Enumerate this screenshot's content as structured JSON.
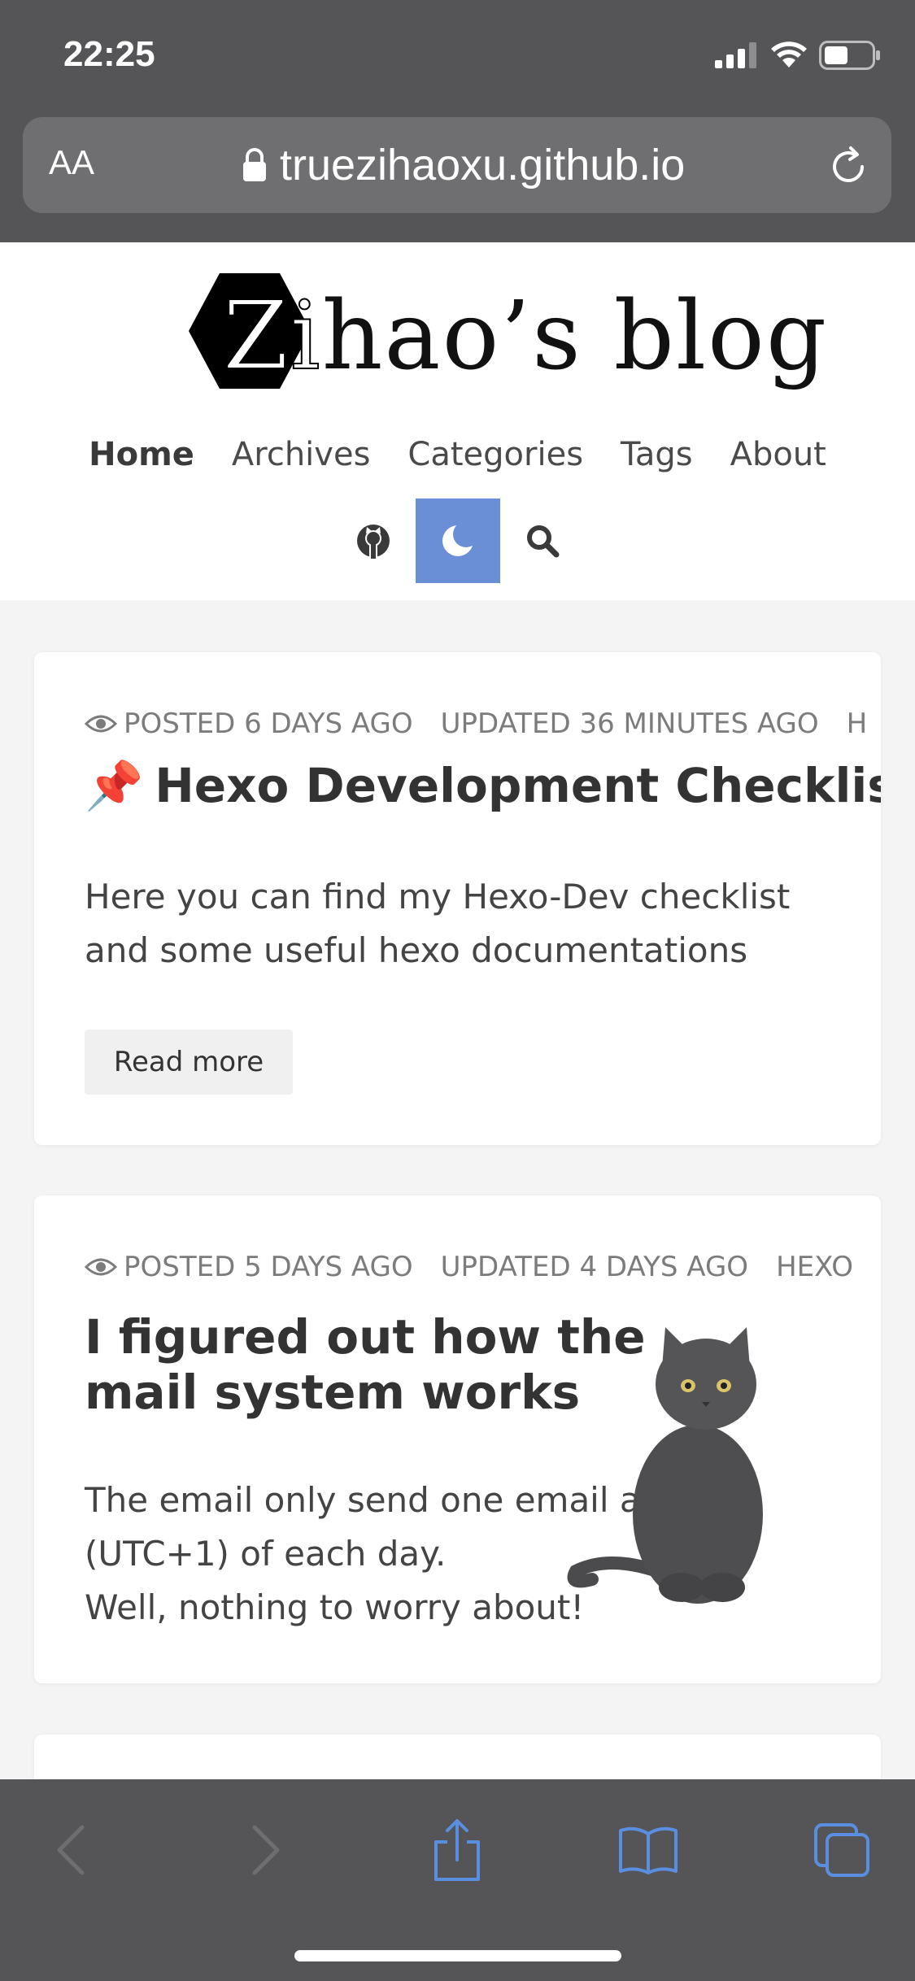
{
  "status_bar": {
    "time": "22:25"
  },
  "address_bar": {
    "aa_label": "AA",
    "url": "truezihaoxu.github.io"
  },
  "blog": {
    "logo_zi": "Zi",
    "logo_rest": "hao’s blog",
    "nav": [
      "Home",
      "Archives",
      "Categories",
      "Tags",
      "About"
    ]
  },
  "posts": [
    {
      "posted": "POSTED 6 DAYS AGO",
      "updated": "UPDATED 36 MINUTES AGO",
      "category": "H",
      "pin": "📌",
      "title": "Hexo Development Checklist",
      "excerpt": "Here you can find my Hexo-Dev checklist and some useful hexo documentations",
      "read_more": "Read more"
    },
    {
      "posted": "POSTED 5 DAYS AGO",
      "updated": "UPDATED 4 DAYS AGO",
      "category": "HEXO",
      "title": "I figured out how the mail system works",
      "excerpt_line1": "The email only send one email at 16:00",
      "excerpt_line2": "(UTC+1) of each day.",
      "excerpt_line3": "Well, nothing to worry about!"
    }
  ],
  "colors": {
    "dark_toggle": "#6a8fd6",
    "toolbar_accent": "#5a8ee0",
    "chrome": "#555557"
  }
}
